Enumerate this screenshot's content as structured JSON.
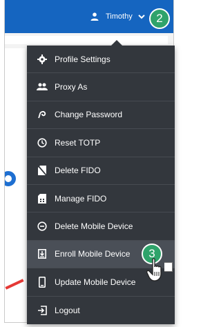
{
  "header": {
    "user_name": "Timothy",
    "step_badge": "2"
  },
  "menu": {
    "items": [
      {
        "label": "Profile Settings",
        "icon": "gear-icon"
      },
      {
        "label": "Proxy As",
        "icon": "users-icon"
      },
      {
        "label": "Change Password",
        "icon": "key-icon"
      },
      {
        "label": "Reset TOTP",
        "icon": "clock-icon"
      },
      {
        "label": "Delete FIDO",
        "icon": "fido-delete-icon"
      },
      {
        "label": "Manage FIDO",
        "icon": "fido-manage-icon"
      },
      {
        "label": "Delete Mobile Device",
        "icon": "minus-circle-icon"
      },
      {
        "label": "Enroll Mobile Device",
        "icon": "enroll-icon"
      },
      {
        "label": "Update Mobile Device",
        "icon": "phone-icon"
      },
      {
        "label": "Logout",
        "icon": "logout-icon"
      }
    ],
    "highlighted_item": "Enroll Mobile Device"
  },
  "callout": {
    "step_badge": "3"
  },
  "colors": {
    "header_bg": "#1565c0",
    "menu_bg": "#33373d",
    "badge": "#2fa36b"
  }
}
